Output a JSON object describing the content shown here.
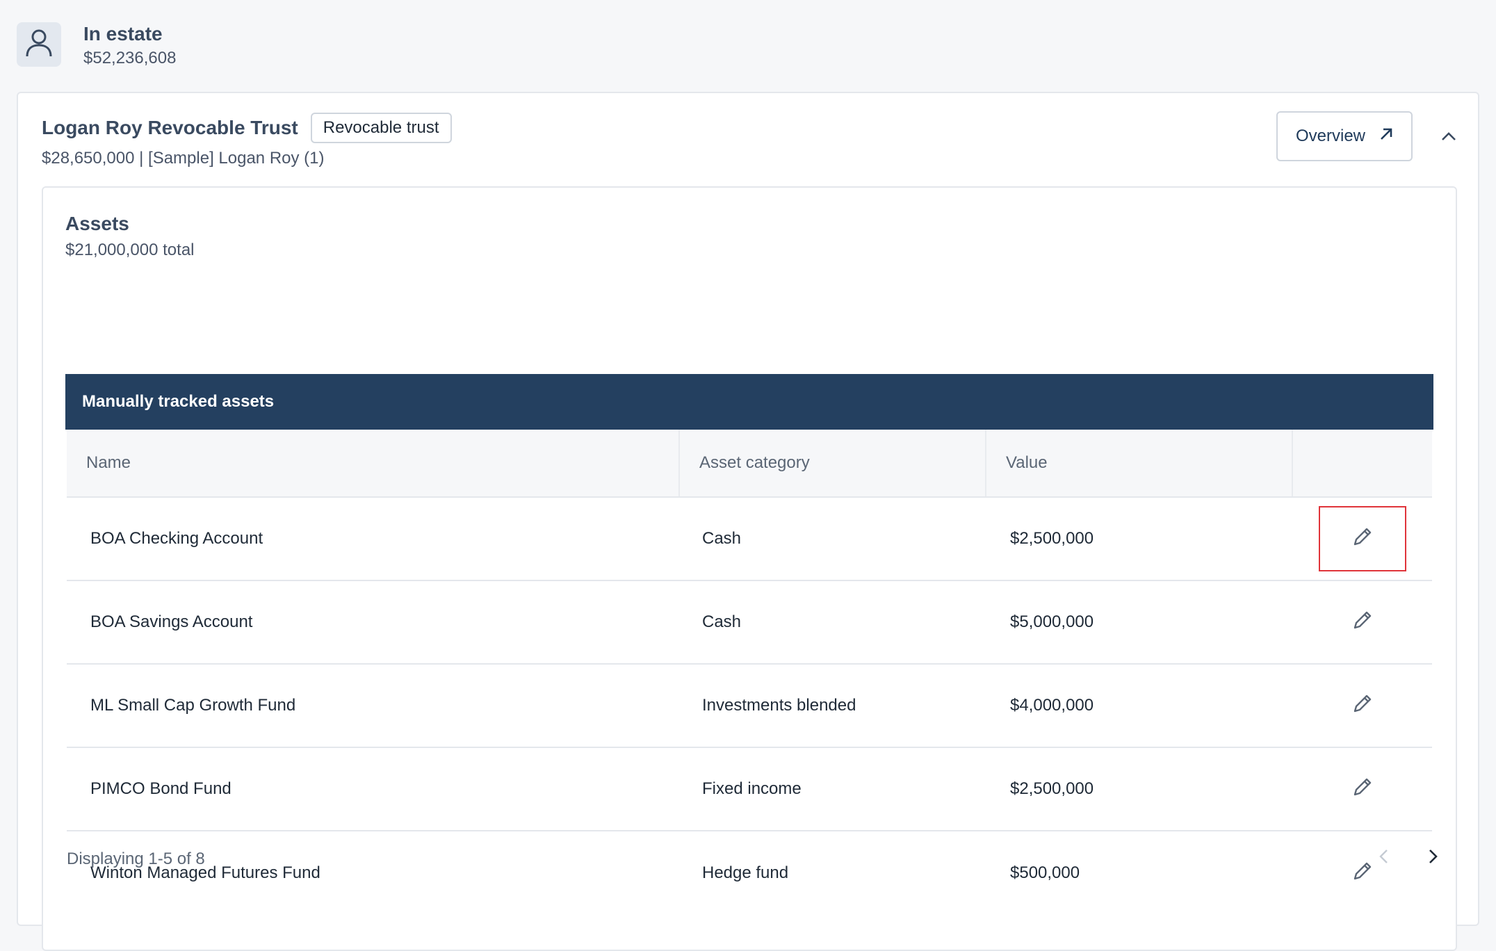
{
  "estate": {
    "icon": "user-icon",
    "title": "In estate",
    "value": "$52,236,608"
  },
  "trust": {
    "title": "Logan Roy Revocable Trust",
    "badge": "Revocable trust",
    "subtitle": "$28,650,000 | [Sample] Logan Roy (1)",
    "overview_label": "Overview",
    "overview_icon": "arrow-up-right-icon",
    "collapse_icon": "chevron-up-icon"
  },
  "assets": {
    "title": "Assets",
    "total": "$21,000,000 total",
    "table_title": "Manually tracked assets",
    "columns": [
      "Name",
      "Asset category",
      "Value",
      ""
    ],
    "rows": [
      {
        "name": "BOA Checking Account",
        "category": "Cash",
        "value": "$2,500,000",
        "action_icon": "pencil-icon",
        "focused": true
      },
      {
        "name": "BOA Savings Account",
        "category": "Cash",
        "value": "$5,000,000",
        "action_icon": "pencil-icon",
        "focused": false
      },
      {
        "name": "ML Small Cap Growth Fund",
        "category": "Investments blended",
        "value": "$4,000,000",
        "action_icon": "pencil-icon",
        "focused": false
      },
      {
        "name": "PIMCO Bond Fund",
        "category": "Fixed income",
        "value": "$2,500,000",
        "action_icon": "pencil-icon",
        "focused": false
      },
      {
        "name": "Winton Managed Futures Fund",
        "category": "Hedge fund",
        "value": "$500,000",
        "action_icon": "pencil-icon",
        "focused": false
      }
    ],
    "pagination": {
      "text": "Displaying 1-5 of 8",
      "prev_icon": "chevron-left-icon",
      "next_icon": "chevron-right-icon"
    }
  },
  "colors": {
    "banner": "#244060",
    "focus_outline": "#e0343a",
    "heading": "#3a4a60"
  }
}
